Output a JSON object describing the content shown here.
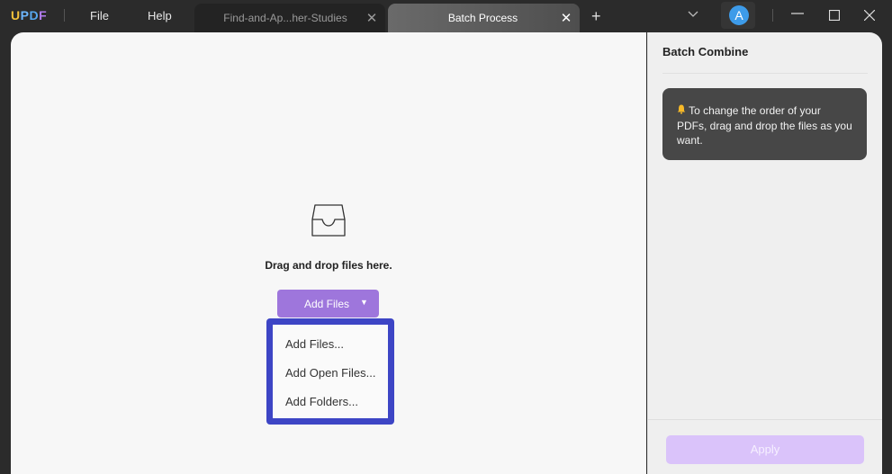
{
  "app": {
    "logo_letters": [
      {
        "ch": "U",
        "color": "#f5c33b"
      },
      {
        "ch": "P",
        "color": "#6db7ff"
      },
      {
        "ch": "D",
        "color": "#58a8f0"
      },
      {
        "ch": "F",
        "color": "#b27cf0"
      }
    ]
  },
  "menu": {
    "file": "File",
    "help": "Help"
  },
  "tabs": [
    {
      "label": "Find-and-Ap...her-Studies",
      "active": false
    },
    {
      "label": "Batch Process",
      "active": true
    }
  ],
  "icons": {
    "close": "✕",
    "plus": "+",
    "chevron_down": "⌄",
    "minimize": "—",
    "maximize": "☐",
    "caret": "▼",
    "bell": "🔔"
  },
  "user": {
    "avatar_initial": "A"
  },
  "main": {
    "drop_text": "Drag and drop files here.",
    "add_button": "Add Files",
    "dropdown_items": [
      "Add Files...",
      "Add Open Files...",
      "Add Folders..."
    ]
  },
  "side": {
    "title": "Batch Combine",
    "notice": "To change the order of your PDFs, drag and drop the files as you want.",
    "apply": "Apply"
  }
}
